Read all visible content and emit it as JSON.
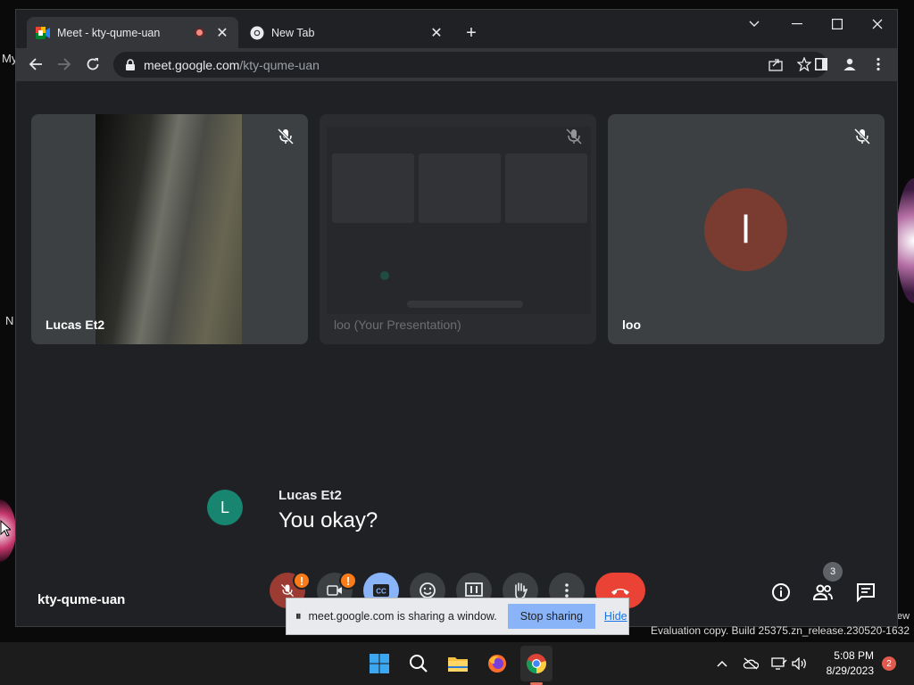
{
  "desktop": {
    "fragment_top": "My",
    "fragment_bottom": "N",
    "fragment_right": "ew"
  },
  "browser": {
    "tabs": [
      {
        "title": "Meet - kty-qume-uan",
        "active": true,
        "recording": true
      },
      {
        "title": "New Tab",
        "active": false
      }
    ],
    "address": {
      "host": "meet.google.com",
      "path": "/kty-qume-uan"
    }
  },
  "meet": {
    "tiles": [
      {
        "name": "Lucas Et2",
        "muted": true
      },
      {
        "name": "loo (Your Presentation)",
        "muted": true
      },
      {
        "name": "loo",
        "muted": true,
        "avatar_letter": "l"
      }
    ],
    "caption": {
      "avatar_letter": "L",
      "speaker": "Lucas Et2",
      "text": "You okay?"
    },
    "meeting_code": "kty-qume-uan",
    "alerts": {
      "mic": "!",
      "camera": "!"
    },
    "people_count": "3"
  },
  "share_bar": {
    "message": "meet.google.com is sharing a window.",
    "stop_label": "Stop sharing",
    "hide_label": "Hide"
  },
  "watermark": "Evaluation copy. Build 25375.zn_release.230520-1632",
  "taskbar": {
    "time": "5:08 PM",
    "date": "8/29/2023",
    "notifications": "2"
  },
  "colors": {
    "meet_bg": "#202124",
    "tile_bg": "#3c4043",
    "end_call": "#ea4335",
    "captions_active": "#8ab4f8",
    "alert": "#fa7b17",
    "caption_avatar": "#188570",
    "loo_avatar": "#7a3b30"
  }
}
